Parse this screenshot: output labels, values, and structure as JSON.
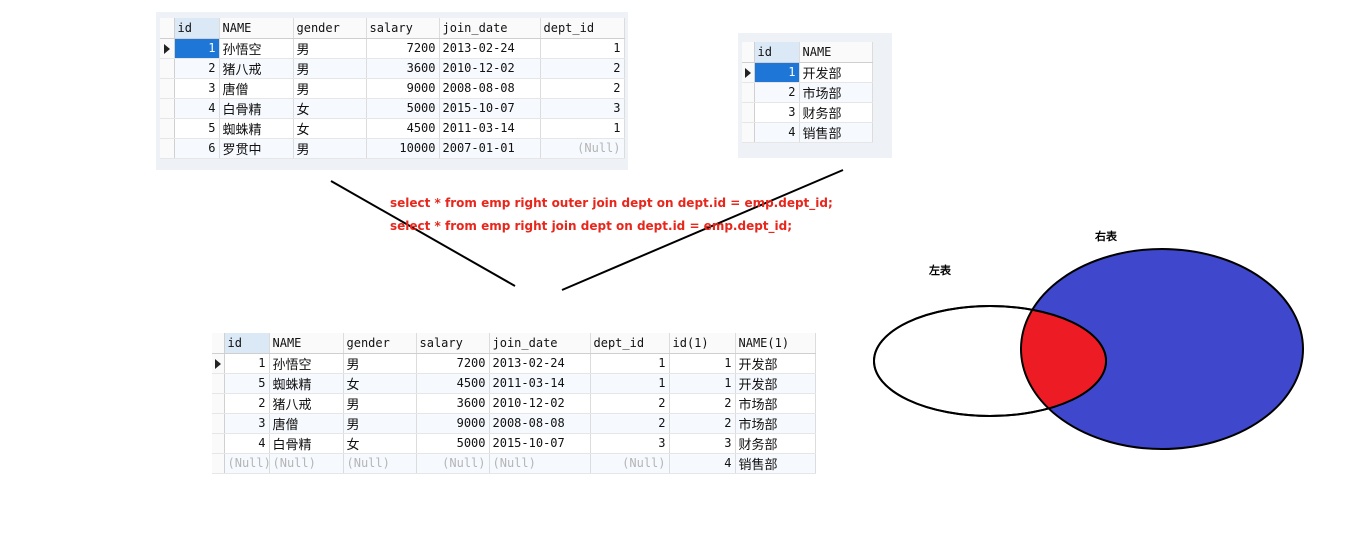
{
  "emp_table": {
    "columns": [
      "id",
      "NAME",
      "gender",
      "salary",
      "join_date",
      "dept_id"
    ],
    "rows": [
      [
        "1",
        "孙悟空",
        "男",
        "7200",
        "2013-02-24",
        "1"
      ],
      [
        "2",
        "猪八戒",
        "男",
        "3600",
        "2010-12-02",
        "2"
      ],
      [
        "3",
        "唐僧",
        "男",
        "9000",
        "2008-08-08",
        "2"
      ],
      [
        "4",
        "白骨精",
        "女",
        "5000",
        "2015-10-07",
        "3"
      ],
      [
        "5",
        "蜘蛛精",
        "女",
        "4500",
        "2011-03-14",
        "1"
      ],
      [
        "6",
        "罗贯中",
        "男",
        "10000",
        "2007-01-01",
        "(Null)"
      ]
    ]
  },
  "dept_table": {
    "columns": [
      "id",
      "NAME"
    ],
    "rows": [
      [
        "1",
        "开发部"
      ],
      [
        "2",
        "市场部"
      ],
      [
        "3",
        "财务部"
      ],
      [
        "4",
        "销售部"
      ]
    ]
  },
  "sql": {
    "line1": "select * from emp right outer join dept on dept.id = emp.dept_id;",
    "line2": "select * from emp right  join dept on dept.id = emp.dept_id;"
  },
  "result_table": {
    "columns": [
      "id",
      "NAME",
      "gender",
      "salary",
      "join_date",
      "dept_id",
      "id(1)",
      "NAME(1)"
    ],
    "rows": [
      [
        "1",
        "孙悟空",
        "男",
        "7200",
        "2013-02-24",
        "1",
        "1",
        "开发部"
      ],
      [
        "5",
        "蜘蛛精",
        "女",
        "4500",
        "2011-03-14",
        "1",
        "1",
        "开发部"
      ],
      [
        "2",
        "猪八戒",
        "男",
        "3600",
        "2010-12-02",
        "2",
        "2",
        "市场部"
      ],
      [
        "3",
        "唐僧",
        "男",
        "9000",
        "2008-08-08",
        "2",
        "2",
        "市场部"
      ],
      [
        "4",
        "白骨精",
        "女",
        "5000",
        "2015-10-07",
        "3",
        "3",
        "财务部"
      ],
      [
        "(Null)",
        "(Null)",
        "(Null)",
        "(Null)",
        "(Null)",
        "(Null)",
        "4",
        "销售部"
      ]
    ]
  },
  "venn": {
    "left_label": "左表",
    "right_label": "右表",
    "colors": {
      "right_fill": "#3f48cc",
      "intersection_fill": "#ed1c24",
      "left_fill": "#ffffff"
    }
  }
}
